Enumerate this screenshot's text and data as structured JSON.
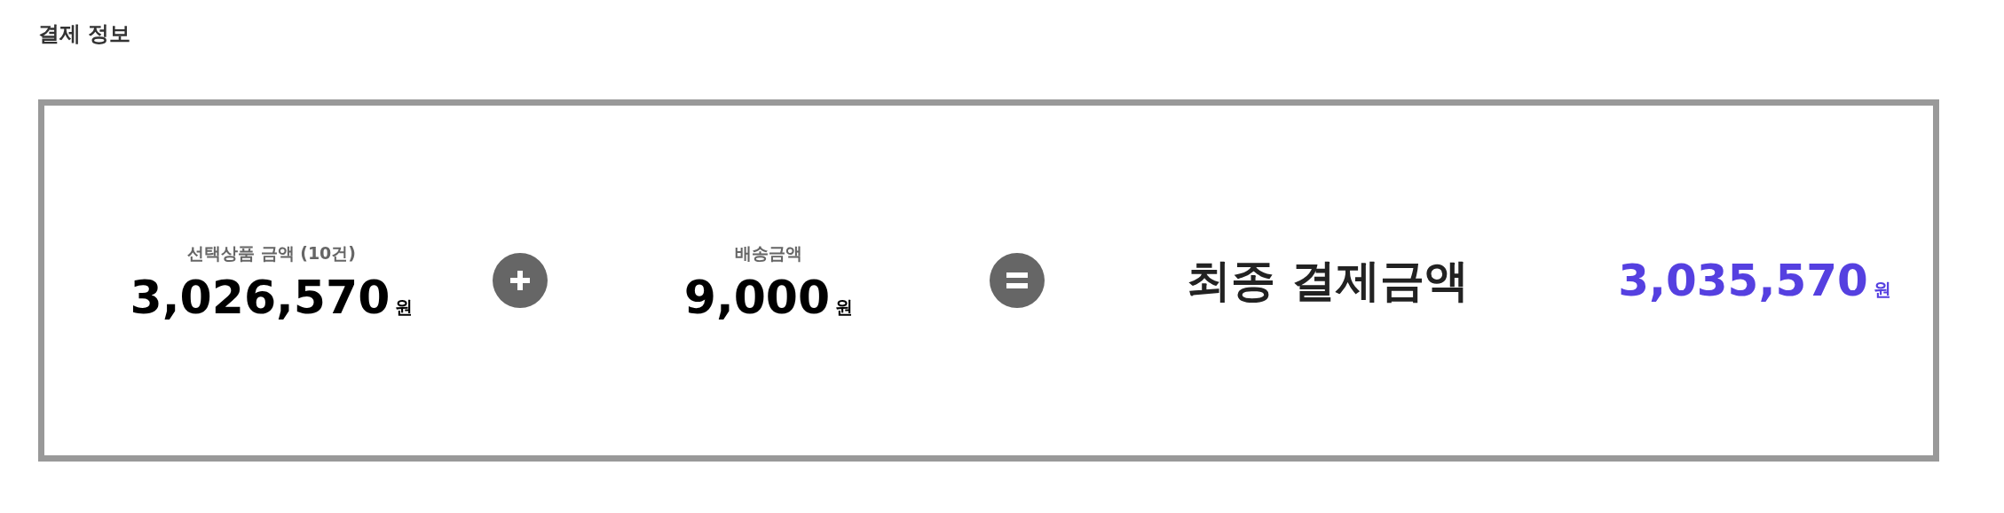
{
  "title": "결제 정보",
  "items": [
    {
      "kind": "amount",
      "label": "선택상품 금액 (10건)",
      "value": "3,026,570",
      "unit": "원"
    },
    {
      "kind": "plus"
    },
    {
      "kind": "amount",
      "label": "배송금액",
      "value": "9,000",
      "unit": "원"
    },
    {
      "kind": "equals"
    },
    {
      "kind": "total",
      "label": "최종 결제금액",
      "value": "3,035,570",
      "unit": "원"
    }
  ]
}
